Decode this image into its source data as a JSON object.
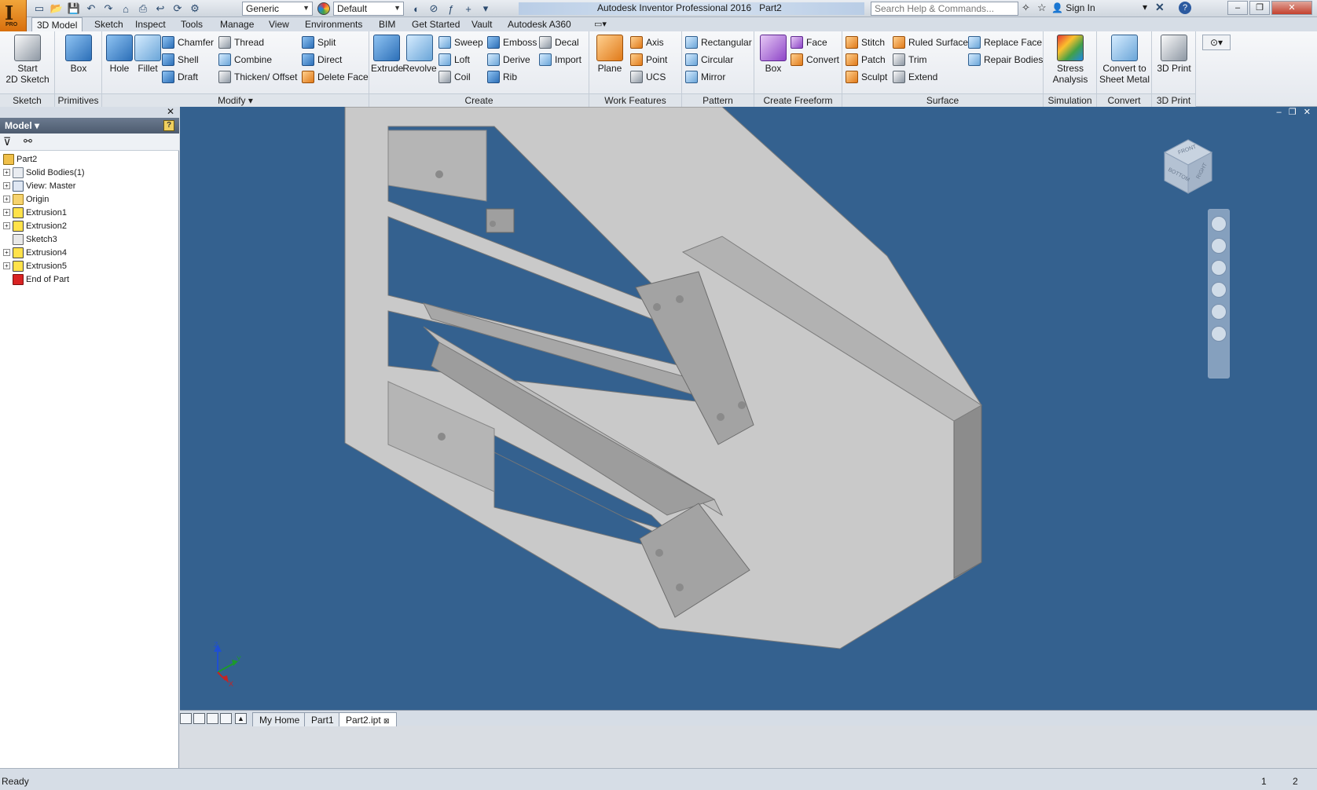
{
  "titlebar": {
    "app_letter": "I",
    "app_badge": "PRO",
    "material_combo": "Generic",
    "appearance_combo": "Default",
    "app_title": "Autodesk Inventor Professional 2016",
    "document_name": "Part2",
    "search_placeholder": "Search Help & Commands...",
    "sign_in": "Sign In"
  },
  "menu": {
    "tabs": [
      "3D Model",
      "Sketch",
      "Inspect",
      "Tools",
      "Manage",
      "View",
      "Environments",
      "BIM",
      "Get Started",
      "Vault",
      "Autodesk A360"
    ],
    "active": "3D Model"
  },
  "ribbon": {
    "sketch": {
      "title": "Sketch",
      "start_sketch": "Start\n2D Sketch"
    },
    "primitives": {
      "title": "Primitives",
      "box": "Box"
    },
    "modify": {
      "title": "Modify",
      "hole": "Hole",
      "fillet": "Fillet",
      "chamfer": "Chamfer",
      "shell": "Shell",
      "draft": "Draft",
      "thread": "Thread",
      "combine": "Combine",
      "thicken": "Thicken/ Offset",
      "split": "Split",
      "direct": "Direct",
      "delete_face": "Delete Face"
    },
    "create": {
      "title": "Create",
      "extrude": "Extrude",
      "revolve": "Revolve",
      "sweep": "Sweep",
      "loft": "Loft",
      "coil": "Coil",
      "emboss": "Emboss",
      "derive": "Derive",
      "rib": "Rib",
      "decal": "Decal",
      "import": "Import"
    },
    "work_features": {
      "title": "Work Features",
      "plane": "Plane",
      "axis": "Axis",
      "point": "Point",
      "ucs": "UCS"
    },
    "pattern": {
      "title": "Pattern",
      "rectangular": "Rectangular",
      "circular": "Circular",
      "mirror": "Mirror"
    },
    "create_freeform": {
      "title": "Create Freeform",
      "box": "Box",
      "face": "Face",
      "convert": "Convert"
    },
    "surface": {
      "title": "Surface",
      "stitch": "Stitch",
      "patch": "Patch",
      "sculpt": "Sculpt",
      "ruled_surface": "Ruled Surface",
      "trim": "Trim",
      "extend": "Extend",
      "replace_face": "Replace Face",
      "repair_bodies": "Repair Bodies"
    },
    "simulation": {
      "title": "Simulation",
      "stress": "Stress\nAnalysis"
    },
    "convert": {
      "title": "Convert",
      "sheet_metal": "Convert to\nSheet Metal"
    },
    "print3d": {
      "title": "3D Print",
      "print": "3D Print"
    }
  },
  "browser": {
    "title": "Model",
    "tree": [
      {
        "label": "Part2",
        "icon": "part-icon",
        "indent": 0,
        "expander": ""
      },
      {
        "label": "Solid Bodies(1)",
        "icon": "solid-body-icon",
        "indent": 1,
        "expander": "+"
      },
      {
        "label": "View: Master",
        "icon": "view-icon",
        "indent": 1,
        "expander": "+"
      },
      {
        "label": "Origin",
        "icon": "folder-icon",
        "indent": 1,
        "expander": "+"
      },
      {
        "label": "Extrusion1",
        "icon": "extrusion-icon",
        "indent": 1,
        "expander": "+"
      },
      {
        "label": "Extrusion2",
        "icon": "extrusion-icon",
        "indent": 1,
        "expander": "+"
      },
      {
        "label": "Sketch3",
        "icon": "sketch-icon",
        "indent": 1,
        "expander": ""
      },
      {
        "label": "Extrusion4",
        "icon": "extrusion-icon",
        "indent": 1,
        "expander": "+"
      },
      {
        "label": "Extrusion5",
        "icon": "extrusion-icon",
        "indent": 1,
        "expander": "+"
      },
      {
        "label": "End of Part",
        "icon": "end-of-part-icon",
        "indent": 1,
        "expander": ""
      }
    ]
  },
  "viewcube": {
    "front": "FRONT",
    "bottom": "BOTTOM",
    "right": "RIGHT"
  },
  "triad": {
    "x": "X",
    "y": "Y",
    "z": "Z"
  },
  "doc_tabs": [
    {
      "label": "My Home",
      "active": false
    },
    {
      "label": "Part1",
      "active": false
    },
    {
      "label": "Part2.ipt",
      "active": true
    }
  ],
  "status": {
    "text": "Ready",
    "num1": "1",
    "num2": "2"
  },
  "colors": {
    "viewport_bg": "#34618f",
    "part_face": "#bdbdbd",
    "accent": "#e07a1a"
  }
}
